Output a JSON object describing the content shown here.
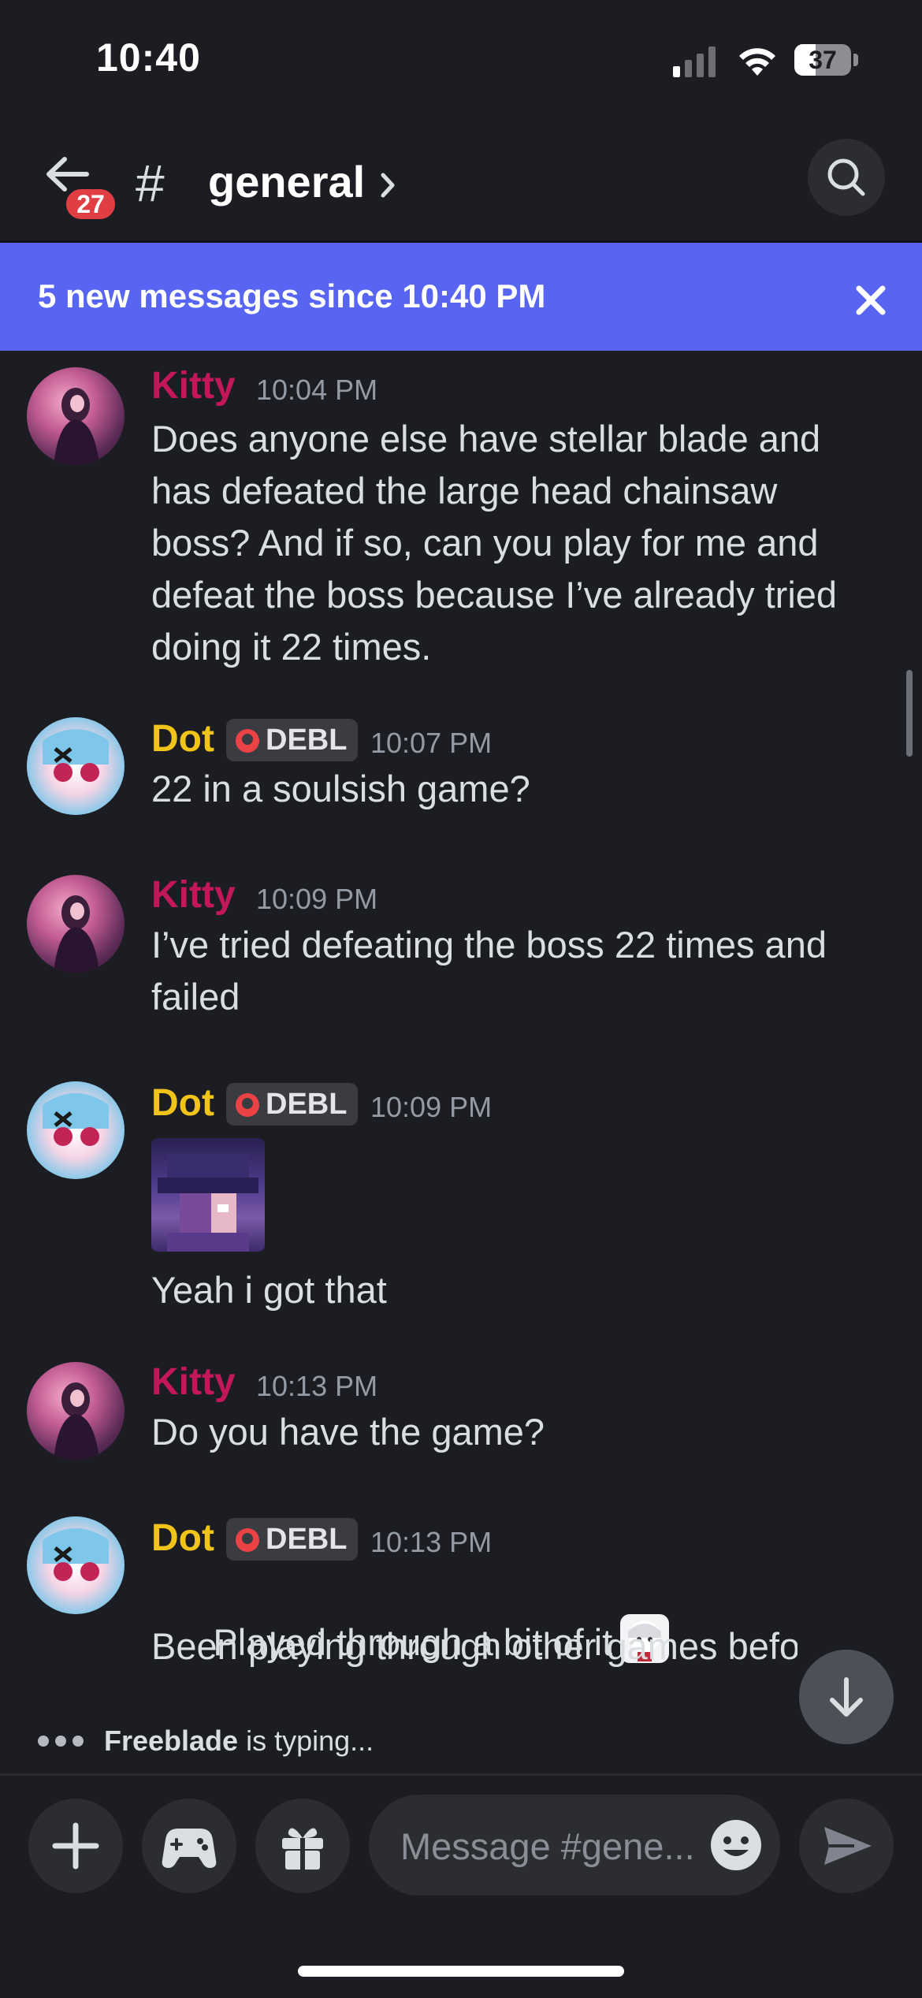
{
  "status_bar": {
    "time": "10:40",
    "battery": "37",
    "battery_level": 0.37
  },
  "header": {
    "back_badge": "27",
    "hash": "#",
    "channel_name": "general",
    "icons": {
      "back": "arrow-left-icon",
      "chevron": "chevron-right-icon",
      "search": "search-icon"
    }
  },
  "new_messages_bar": {
    "text": "5 new messages since 10:40 PM",
    "close_icon": "close-icon"
  },
  "messages": [
    {
      "author": "Kitty",
      "time": "10:04 PM",
      "text": "Does anyone else have stellar blade and has defeated the large head chainsaw boss? And if so, can you play for me and defeat the boss because I’ve already tried doing it 22 times."
    },
    {
      "author": "Dot",
      "tag": "DEBL",
      "time": "10:07 PM",
      "text": "22 in a soulsish game?"
    },
    {
      "author": "Kitty",
      "time": "10:09 PM",
      "text": "I’ve tried defeating the boss 22 times and failed"
    },
    {
      "author": "Dot",
      "tag": "DEBL",
      "time": "10:09 PM",
      "text": "Yeah i got that"
    },
    {
      "author": "Kitty",
      "time": "10:13 PM",
      "text": "Do you have the game?"
    },
    {
      "author": "Dot",
      "tag": "DEBL",
      "time": "10:13 PM",
      "text": "Played through a bit of it",
      "text2": "Been playing through other games befo"
    }
  ],
  "typing": {
    "name": "Freeblade",
    "suffix": " is typing..."
  },
  "composer": {
    "placeholder": "Message #gene...",
    "icons": {
      "add": "plus-icon",
      "games": "gamepad-icon",
      "gift": "gift-icon",
      "emoji": "emoji-icon",
      "send": "send-icon"
    }
  },
  "colors": {
    "background": "#1c1d22",
    "blurple": "#5865f2",
    "kitty_name": "#c2185b",
    "dot_name": "#f0c419",
    "badge_red": "#e13e44"
  }
}
